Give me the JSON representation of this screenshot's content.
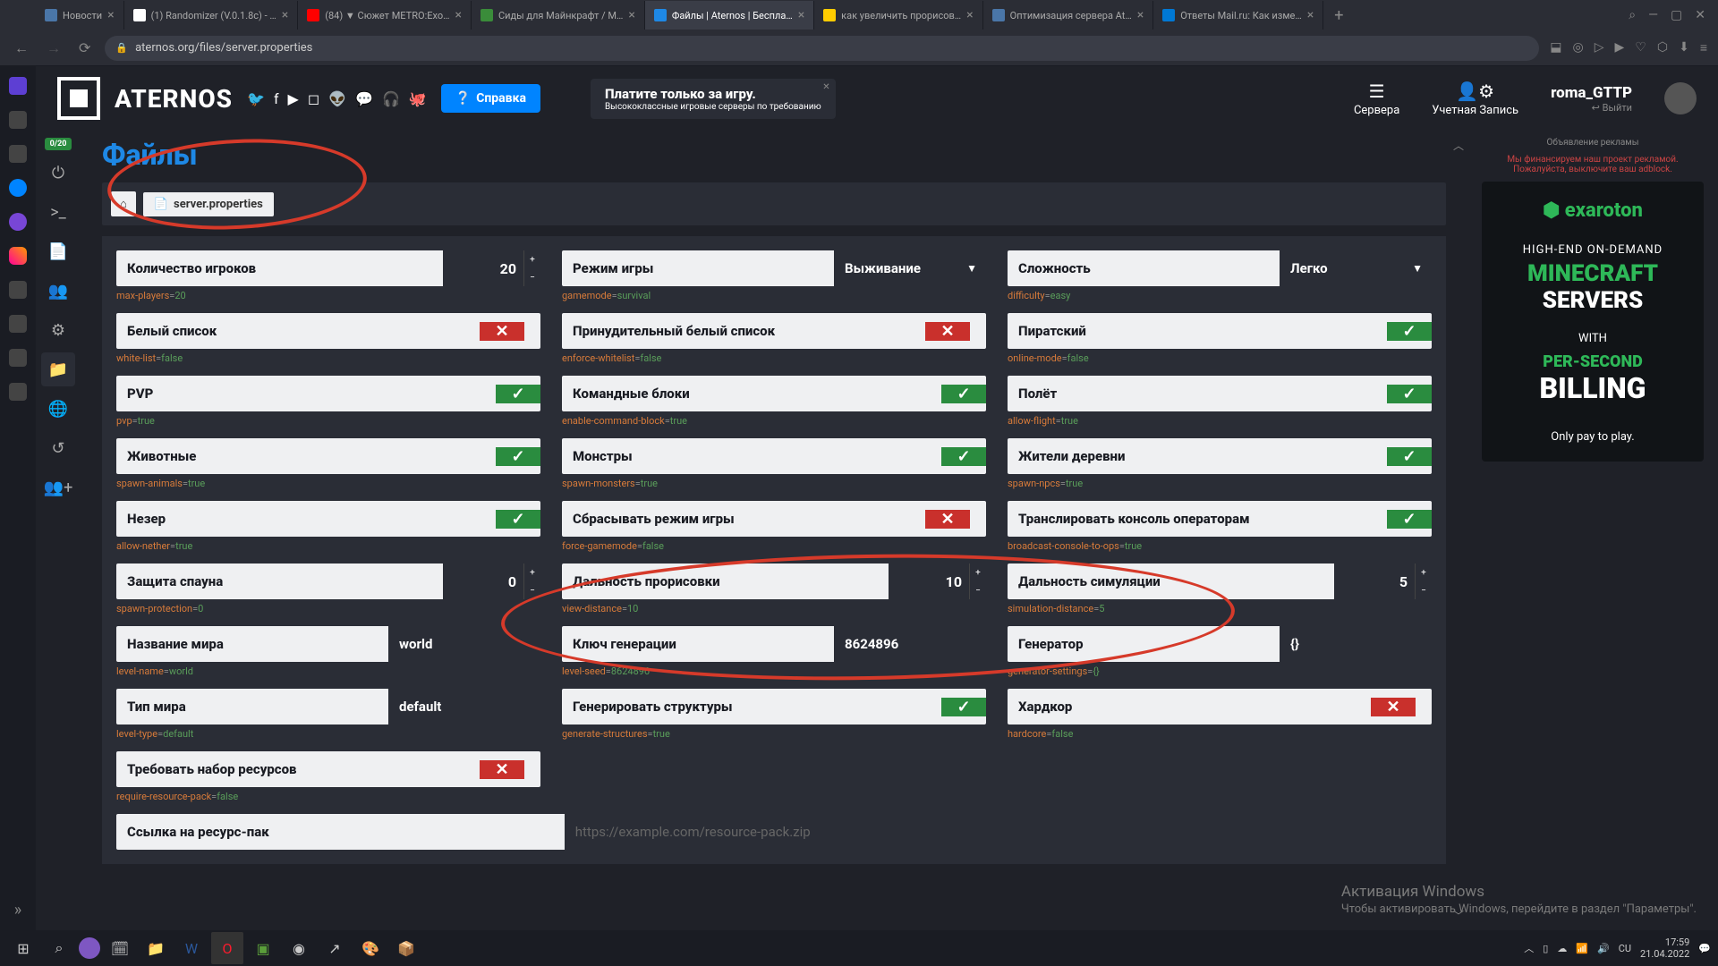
{
  "browser": {
    "tabs": [
      {
        "title": "Новости",
        "color": "#4a76a8"
      },
      {
        "title": "(1) Randomizer (V.0.1.8c) - …",
        "color": "#fff"
      },
      {
        "title": "(84) ▼ Сюжет METRO:Exo…",
        "color": "#ff0000"
      },
      {
        "title": "Сиды для Майнкрафт / М…",
        "color": "#3a8c3a"
      },
      {
        "title": "Файлы | Aternos | Беспла…",
        "color": "#1e88e5",
        "active": true
      },
      {
        "title": "как увеличить прорисов…",
        "color": "#ffcc00"
      },
      {
        "title": "Оптимизация сервера At…",
        "color": "#4a76a8"
      },
      {
        "title": "Ответы Mail.ru: Как изме…",
        "color": "#0078d4"
      }
    ],
    "url": "aternos.org/files/server.properties"
  },
  "header": {
    "brand": "ATERNOS",
    "help": "Справка",
    "exaroton": {
      "line1": "Платите только за игру.",
      "line2": "Высококлассные игровые серверы по требованию"
    },
    "nav_servers": "Сервера",
    "nav_account": "Учетная Запись",
    "username": "roma_GTTP",
    "logout": "Выйти"
  },
  "sidebar": {
    "badge": "0/20"
  },
  "page": {
    "title": "Файлы",
    "breadcrumb_file": "server.properties"
  },
  "props": {
    "max_players": {
      "label": "Количество игроков",
      "value": "20",
      "key": "max-players",
      "val": "20"
    },
    "gamemode": {
      "label": "Режим игры",
      "value": "Выживание",
      "key": "gamemode",
      "val": "survival"
    },
    "difficulty": {
      "label": "Сложность",
      "value": "Легко",
      "key": "difficulty",
      "val": "easy"
    },
    "whitelist": {
      "label": "Белый список",
      "on": false,
      "key": "white-list",
      "val": "false"
    },
    "enforce_wl": {
      "label": "Принудительный белый список",
      "on": false,
      "key": "enforce-whitelist",
      "val": "false"
    },
    "online": {
      "label": "Пиратский",
      "on": true,
      "key": "online-mode",
      "val": "false"
    },
    "pvp": {
      "label": "PVP",
      "on": true,
      "key": "pvp",
      "val": "true"
    },
    "cmd_blocks": {
      "label": "Командные блоки",
      "on": true,
      "key": "enable-command-block",
      "val": "true"
    },
    "flight": {
      "label": "Полёт",
      "on": true,
      "key": "allow-flight",
      "val": "true"
    },
    "animals": {
      "label": "Животные",
      "on": true,
      "key": "spawn-animals",
      "val": "true"
    },
    "monsters": {
      "label": "Монстры",
      "on": true,
      "key": "spawn-monsters",
      "val": "true"
    },
    "npcs": {
      "label": "Жители деревни",
      "on": true,
      "key": "spawn-npcs",
      "val": "true"
    },
    "nether": {
      "label": "Незер",
      "on": true,
      "key": "allow-nether",
      "val": "true"
    },
    "force_gm": {
      "label": "Сбрасывать режим игры",
      "on": false,
      "key": "force-gamemode",
      "val": "false"
    },
    "broadcast": {
      "label": "Транслировать консоль операторам",
      "on": true,
      "key": "broadcast-console-to-ops",
      "val": "true"
    },
    "spawn_prot": {
      "label": "Защита спауна",
      "value": "0",
      "key": "spawn-protection",
      "val": "0"
    },
    "view_dist": {
      "label": "Дальность прорисовки",
      "value": "10",
      "key": "view-distance",
      "val": "10"
    },
    "sim_dist": {
      "label": "Дальность симуляции",
      "value": "5",
      "key": "simulation-distance",
      "val": "5"
    },
    "level_name": {
      "label": "Название мира",
      "value": "world",
      "key": "level-name",
      "val": "world"
    },
    "seed": {
      "label": "Ключ генерации",
      "value": "8624896",
      "key": "level-seed",
      "val": "8624896"
    },
    "generator": {
      "label": "Генератор",
      "value": "{}",
      "key": "generator-settings",
      "val": "{}"
    },
    "level_type": {
      "label": "Тип мира",
      "value": "default",
      "key": "level-type",
      "val": "default"
    },
    "structures": {
      "label": "Генерировать структуры",
      "on": true,
      "key": "generate-structures",
      "val": "true"
    },
    "hardcore": {
      "label": "Хардкор",
      "on": false,
      "key": "hardcore",
      "val": "false"
    },
    "req_pack": {
      "label": "Требовать набор ресурсов",
      "on": false,
      "key": "require-resource-pack",
      "val": "false"
    },
    "pack_url": {
      "label": "Ссылка на ресурс-пак",
      "placeholder": "https://example.com/resource-pack.zip"
    }
  },
  "ads": {
    "label": "Объявление рекламы",
    "notice": "Мы финансируем наш проект рекламой. Пожалуйста, выключите ваш adblock.",
    "banner": {
      "logo": "⬢ exaroton",
      "t1": "HIGH-END ON-DEMAND",
      "t2": "MINECRAFT",
      "t3": "SERVERS",
      "t4": "WITH",
      "t5": "PER-SECOND",
      "t6": "BILLING",
      "t7": "Only pay to play."
    }
  },
  "winact": {
    "l1": "Активация Windows",
    "l2": "Чтобы активировать Windows, перейдите в раздел \"Параметры\"."
  },
  "taskbar": {
    "lang": "CU",
    "time": "17:59",
    "date": "21.04.2022"
  }
}
